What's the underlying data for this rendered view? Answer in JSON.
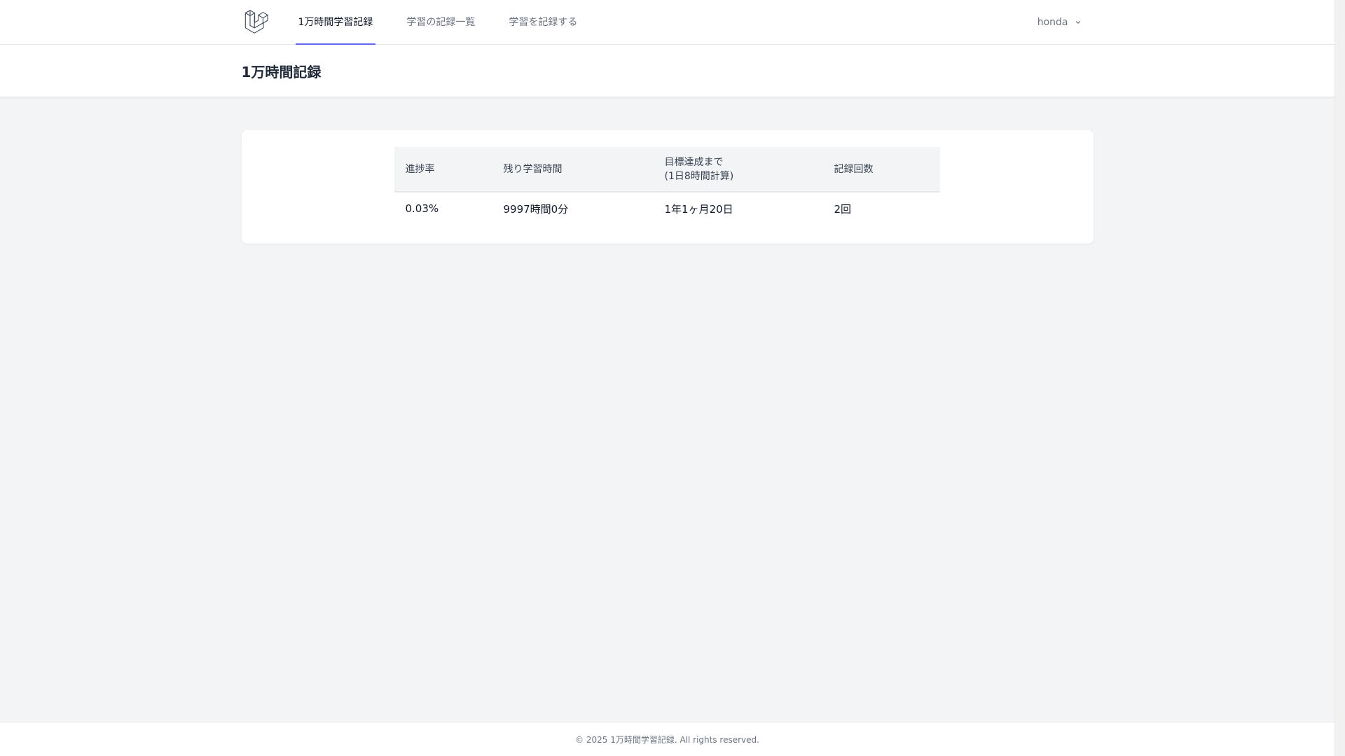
{
  "nav": {
    "links": [
      {
        "label": "1万時間学習記録",
        "active": true
      },
      {
        "label": "学習の記録一覧",
        "active": false
      },
      {
        "label": "学習を記録する",
        "active": false
      }
    ],
    "user_name": "honda",
    "accent_color": "#6366f1"
  },
  "header": {
    "title": "1万時間記録"
  },
  "stats_table": {
    "headers": [
      "進捗率",
      "残り学習時間",
      "目標達成まで",
      "(1日8時間計算)",
      "記録回数"
    ],
    "row": {
      "progress": "0.03%",
      "remaining": "9997時間0分",
      "eta": "1年1ヶ月20日",
      "count": "2回"
    }
  },
  "footer": {
    "text": "© 2025 1万時間学習記録. All rights reserved."
  }
}
